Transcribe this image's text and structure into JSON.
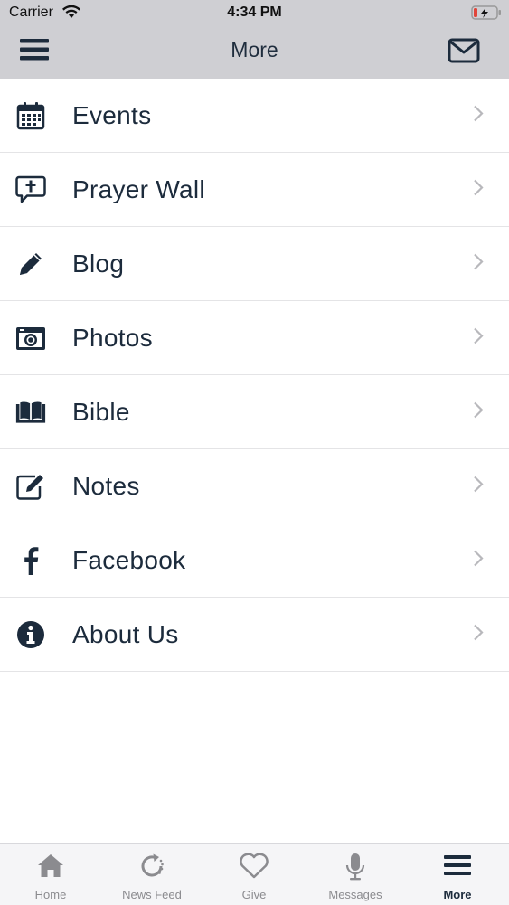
{
  "status_bar": {
    "carrier": "Carrier",
    "time": "4:34 PM"
  },
  "nav": {
    "title": "More"
  },
  "menu": [
    {
      "label": "Events",
      "icon": "calendar-icon"
    },
    {
      "label": "Prayer Wall",
      "icon": "prayer-bubble-icon"
    },
    {
      "label": "Blog",
      "icon": "pencil-icon"
    },
    {
      "label": "Photos",
      "icon": "camera-icon"
    },
    {
      "label": "Bible",
      "icon": "book-icon"
    },
    {
      "label": "Notes",
      "icon": "edit-note-icon"
    },
    {
      "label": "Facebook",
      "icon": "facebook-icon"
    },
    {
      "label": "About Us",
      "icon": "info-icon"
    }
  ],
  "tabs": [
    {
      "label": "Home",
      "icon": "home-icon",
      "active": false
    },
    {
      "label": "News Feed",
      "icon": "refresh-icon",
      "active": false
    },
    {
      "label": "Give",
      "icon": "heart-icon",
      "active": false
    },
    {
      "label": "Messages",
      "icon": "microphone-icon",
      "active": false
    },
    {
      "label": "More",
      "icon": "menu-icon",
      "active": true
    }
  ],
  "colors": {
    "accent": "#1c2b3c",
    "header_bg": "#cfcfd3",
    "tab_inactive": "#8b8b8f",
    "battery_low": "#e0453a"
  }
}
